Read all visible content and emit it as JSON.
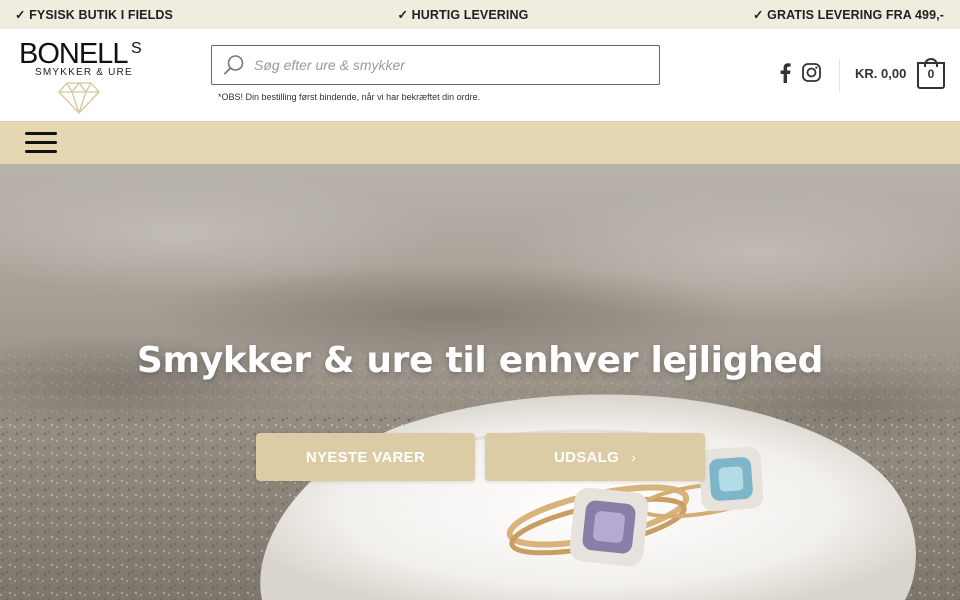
{
  "topbar": {
    "items": [
      "✓ FYSISK BUTIK I FIELDS",
      "✓ HURTIG LEVERING",
      "✓ GRATIS LEVERING FRA 499,-"
    ]
  },
  "logo": {
    "name": "BONELL",
    "superscript": "S",
    "tagline": "SMYKKER & URE"
  },
  "search": {
    "placeholder": "Søg efter ure & smykker",
    "value": ""
  },
  "notice": "*OBS! Din bestilling først bindende, når vi har bekræftet din ordre.",
  "social": {
    "icons": [
      "facebook-icon",
      "instagram-icon"
    ]
  },
  "cart": {
    "total": "KR. 0,00",
    "count": "0"
  },
  "hero": {
    "title": "Smykker & ure til enhver lejlighed",
    "buttons": {
      "new": "NYESTE VARER",
      "sale": "UDSALG",
      "sale_chevron": "›"
    }
  },
  "colors": {
    "topbar_bg": "#f1ece0",
    "nav_bg": "#e5d7b2",
    "button_bg": "#dccca6",
    "text_dark": "#222222"
  }
}
